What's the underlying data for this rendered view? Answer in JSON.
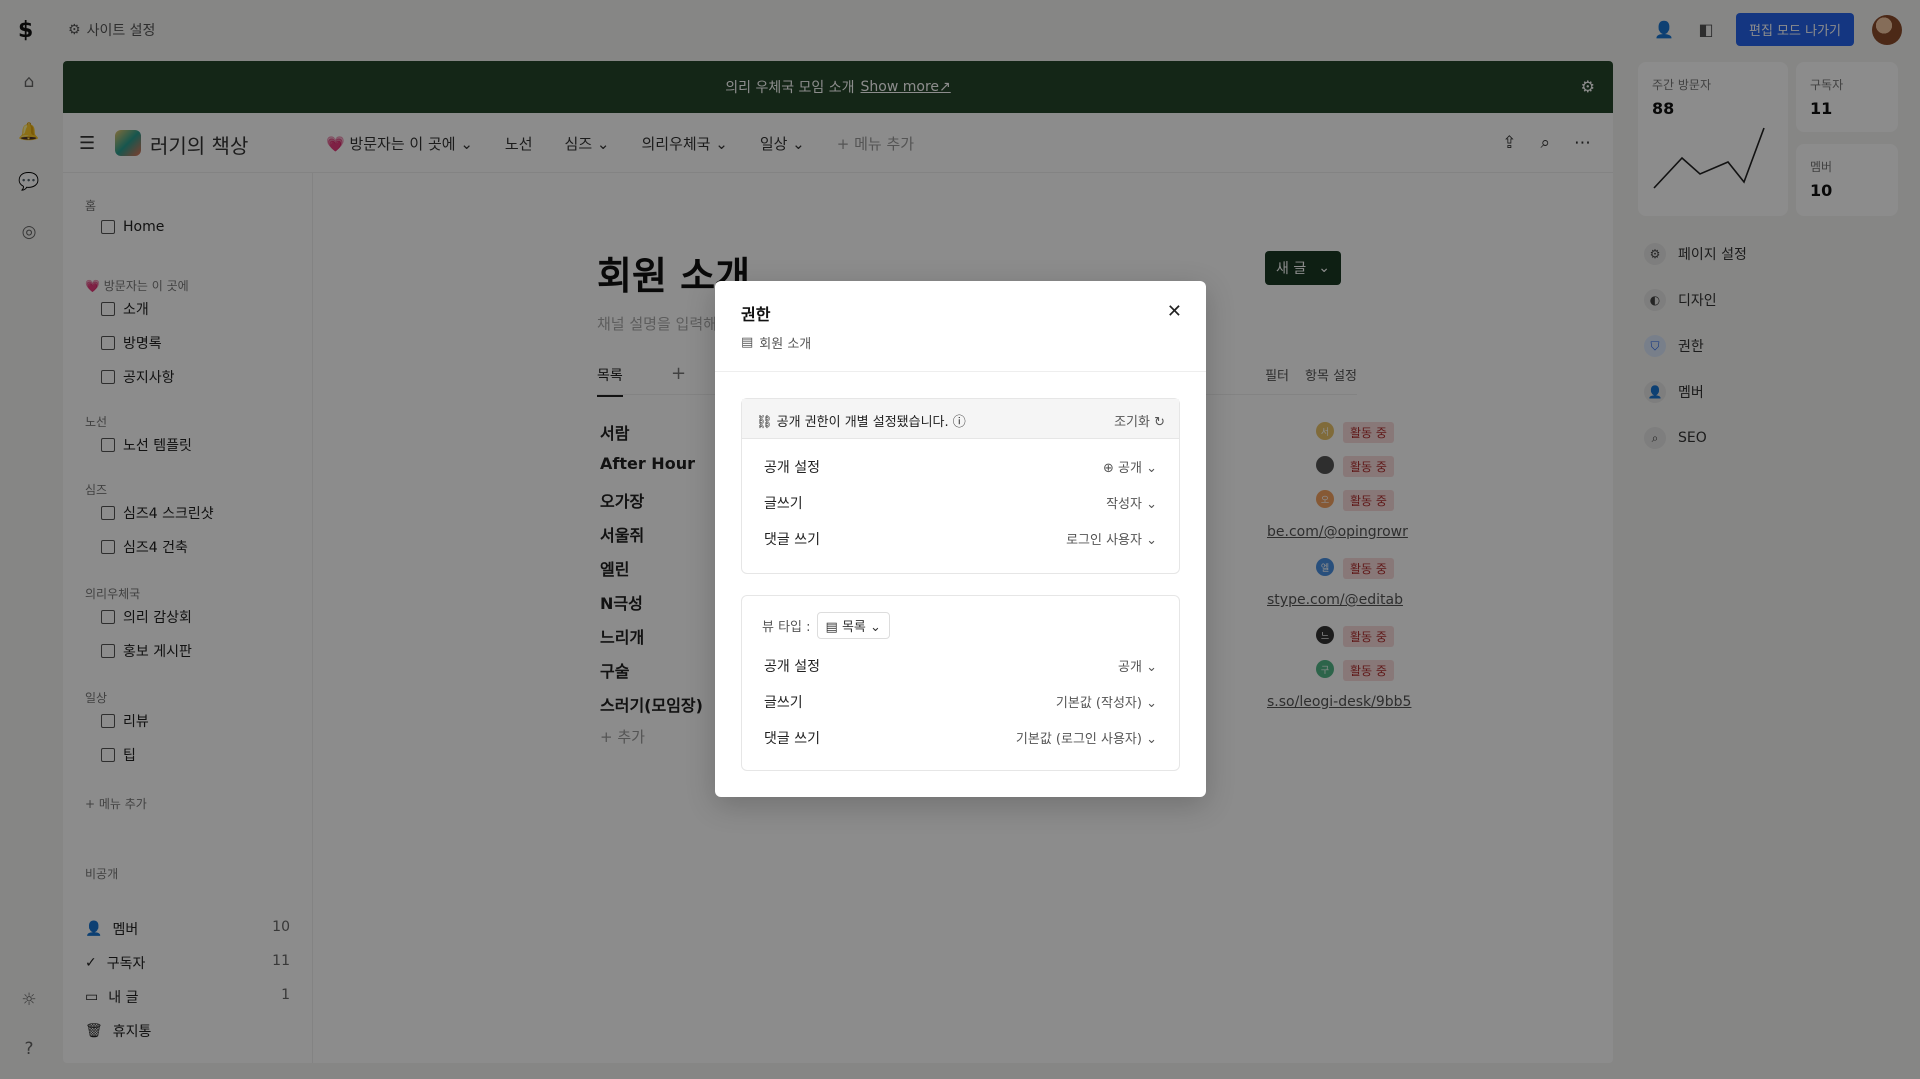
{
  "topbar": {
    "site_settings": "사이트 설정",
    "exit_edit": "편집 모드 나가기"
  },
  "banner": {
    "text": "의리 우체국 모임 소개",
    "more": "Show more↗"
  },
  "nav": {
    "site_title": "러기의 책상",
    "menu": [
      {
        "label": "💗 방문자는 이 곳에 ⌄"
      },
      {
        "label": "노선"
      },
      {
        "label": "심즈 ⌄"
      },
      {
        "label": "의리우체국 ⌄"
      },
      {
        "label": "일상 ⌄"
      },
      {
        "label": "+ 메뉴 추가"
      }
    ]
  },
  "sidebar": {
    "sections": [
      {
        "label": "홈",
        "items": [
          "Home"
        ]
      },
      {
        "label": "💗 방문자는 이 곳에",
        "items": [
          "소개",
          "방명록",
          "공지사항"
        ]
      },
      {
        "label": "노선",
        "items": [
          "노선 템플릿"
        ]
      },
      {
        "label": "심즈",
        "items": [
          "심즈4 스크린샷",
          "심즈4 건축"
        ]
      },
      {
        "label": "의리우체국",
        "items": [
          "의리 감상회",
          "홍보 게시판"
        ]
      },
      {
        "label": "일상",
        "items": [
          "리뷰",
          "팁"
        ]
      }
    ],
    "add_menu": "+ 메뉴 추가",
    "private_label": "비공개",
    "bottom": [
      {
        "label": "멤버",
        "count": "10"
      },
      {
        "label": "구독자",
        "count": "11"
      },
      {
        "label": "내 글",
        "count": "1"
      },
      {
        "label": "휴지통",
        "count": ""
      }
    ]
  },
  "content": {
    "title": "회원 소개",
    "description": "채널 설명을 입력해",
    "new_post": "새 글",
    "tab_list": "목록",
    "filter": "필터",
    "field_settings": "항목 설정",
    "rows": [
      "서람",
      "After Hour",
      "오가장",
      "서울쥐",
      "엘린",
      "N극성",
      "느리개",
      "구술",
      "스러기(모임장)"
    ],
    "add": "+ 추가",
    "status": "활동 중",
    "links": [
      "be.com/@opingrowr",
      "stype.com/@editab",
      "s.so/leogi-desk/9bb5"
    ],
    "avatar_initials": [
      "서",
      "오",
      "엘",
      "느",
      "구"
    ]
  },
  "right_panel": {
    "weekly_visitors_label": "주간 방문자",
    "weekly_visitors": "88",
    "subscribers_label": "구독자",
    "subscribers": "11",
    "members_label": "멤버",
    "members": "10",
    "items": [
      "페이지 설정",
      "디자인",
      "권한",
      "멤버",
      "SEO"
    ]
  },
  "modal": {
    "title": "권한",
    "subtitle": "회원 소개",
    "notice": "공개 권한이 개별 설정됐습니다.",
    "reset": "조기화",
    "top_rows": [
      {
        "key": "공개 설정",
        "value": "공개"
      },
      {
        "key": "글쓰기",
        "value": "작성자"
      },
      {
        "key": "댓글 쓰기",
        "value": "로그인 사용자"
      }
    ],
    "view_type_label": "뷰 타입 :",
    "view_type_value": "목록",
    "bottom_rows": [
      {
        "key": "공개 설정",
        "value": "공개"
      },
      {
        "key": "글쓰기",
        "value": "기본값 (작성자)"
      },
      {
        "key": "댓글 쓰기",
        "value": "기본값 (로그인 사용자)"
      }
    ]
  }
}
